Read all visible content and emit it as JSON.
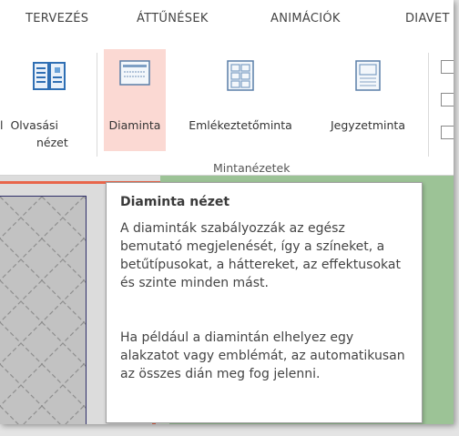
{
  "tabs": [
    "TERVEZÉS",
    "ÁTTŰNÉSEK",
    "ANIMÁCIÓK",
    "DIAVET"
  ],
  "ribbon": {
    "reading_view": {
      "line1": "Olvasási",
      "line2": "nézet",
      "cut_prefix": "l"
    },
    "slide_master": {
      "label": "Diaminta"
    },
    "handout_master": {
      "label": "Emlékeztetőminta"
    },
    "notes_master": {
      "label": "Jegyzetminta"
    },
    "group_label": "Mintanézetek"
  },
  "tooltip": {
    "title": "Diaminta nézet",
    "para1": "A diaminták szabályozzák az egész bemutató megjelenését, így a színeket, a betűtípusokat, a háttereket, az effektusokat és szinte minden mást.",
    "para2": "Ha például a diamintán elhelyez egy alakzatot vagy emblémát, az automatikusan az összes dián meg fog jelenni."
  },
  "colors": {
    "active_button": "#fbd9d3",
    "accent_orange": "#e8664b",
    "slide_green": "#9cc396"
  }
}
